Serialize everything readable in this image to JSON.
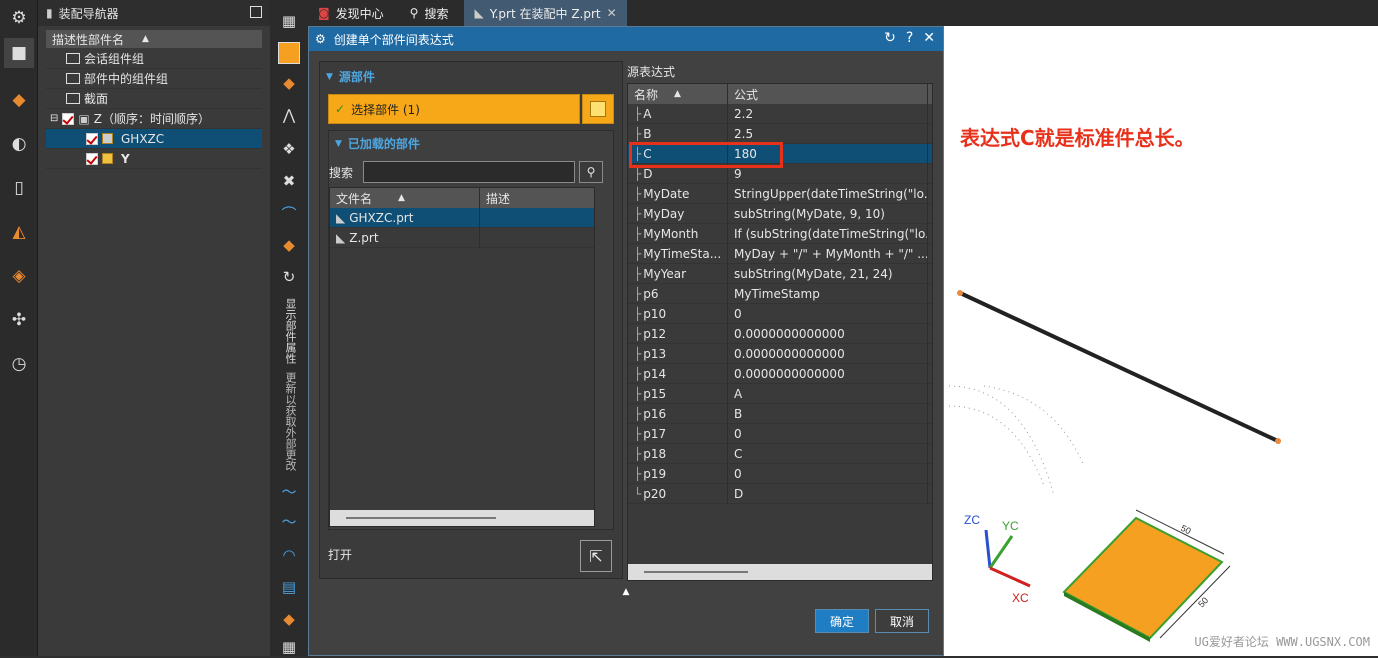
{
  "rail": {
    "icons": [
      "gear-icon",
      "assembly-navigator-icon",
      "assembly-constraints-icon",
      "part-navigator-icon",
      "reuse-library-icon",
      "history-icon",
      "roles-icon",
      "measure-icon",
      "clock-icon"
    ]
  },
  "navigator": {
    "title": "装配导航器",
    "column": "描述性部件名",
    "tree": [
      {
        "label": "会话组件组",
        "type": "folder"
      },
      {
        "label": "部件中的组件组",
        "type": "folder"
      },
      {
        "label": "截面",
        "type": "folder"
      },
      {
        "label": "Z（顺序：时间顺序）",
        "type": "assembly"
      },
      {
        "label": "GHXZC",
        "type": "part"
      },
      {
        "label": "Y",
        "type": "part"
      }
    ]
  },
  "toolbar": {
    "vertical_labels": [
      "显示部件属性",
      "更新以获取外部更改"
    ]
  },
  "tabs": [
    {
      "label": "发现中心"
    },
    {
      "label": "搜索"
    },
    {
      "label": "Y.prt 在装配中 Z.prt"
    }
  ],
  "dialog": {
    "title": "创建单个部件间表达式",
    "source_section": "源部件",
    "select_part": "选择部件 (1)",
    "loaded_section": "已加载的部件",
    "search_label": "搜索",
    "file_columns": [
      "文件名",
      "描述"
    ],
    "files": [
      {
        "name": "GHXZC.prt",
        "desc": ""
      },
      {
        "name": "Z.prt",
        "desc": ""
      }
    ],
    "open_label": "打开",
    "expr_section": "源表达式",
    "expr_columns": [
      "名称",
      "公式"
    ],
    "expressions": [
      {
        "name": "A",
        "formula": "2.2"
      },
      {
        "name": "B",
        "formula": "2.5"
      },
      {
        "name": "C",
        "formula": "180"
      },
      {
        "name": "D",
        "formula": "9"
      },
      {
        "name": "MyDate",
        "formula": "StringUpper(dateTimeString(\"lo..."
      },
      {
        "name": "MyDay",
        "formula": "subString(MyDate, 9, 10)"
      },
      {
        "name": "MyMonth",
        "formula": "If (subString(dateTimeString(\"lo..."
      },
      {
        "name": "MyTimeSta...",
        "formula": "MyDay + \"/\" + MyMonth + \"/\" ..."
      },
      {
        "name": "MyYear",
        "formula": "subString(MyDate, 21, 24)"
      },
      {
        "name": "p6",
        "formula": "MyTimeStamp"
      },
      {
        "name": "p10",
        "formula": "0"
      },
      {
        "name": "p12",
        "formula": "0.0000000000000"
      },
      {
        "name": "p13",
        "formula": "0.0000000000000"
      },
      {
        "name": "p14",
        "formula": "0.0000000000000"
      },
      {
        "name": "p15",
        "formula": "A"
      },
      {
        "name": "p16",
        "formula": "B"
      },
      {
        "name": "p17",
        "formula": "0"
      },
      {
        "name": "p18",
        "formula": "C"
      },
      {
        "name": "p19",
        "formula": "0"
      },
      {
        "name": "p20",
        "formula": "D"
      }
    ],
    "ok": "确定",
    "cancel": "取消"
  },
  "graphics": {
    "annotation": "表达式C就是标准件总长。",
    "axes": {
      "zc": "ZC",
      "yc": "YC",
      "xc": "XC"
    },
    "dims": [
      "50",
      "50"
    ],
    "watermark": "UG爱好者论坛 WWW.UGSNX.COM"
  },
  "colors": {
    "highlight_red": "#e8311b",
    "plate_orange": "#f5a020",
    "selected_row": "#0f4f76",
    "select_button": "#f6a818"
  }
}
